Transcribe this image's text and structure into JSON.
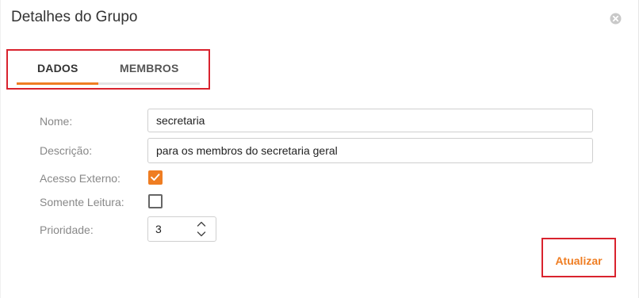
{
  "dialog": {
    "title": "Detalhes do Grupo"
  },
  "tabs": [
    {
      "label": "DADOS",
      "active": true
    },
    {
      "label": "MEMBROS",
      "active": false
    }
  ],
  "form": {
    "nome": {
      "label": "Nome:",
      "value": "secretaria"
    },
    "descricao": {
      "label": "Descrição:",
      "value": "para os membros do secretaria geral"
    },
    "acesso_externo": {
      "label": "Acesso Externo:",
      "checked": true
    },
    "somente_leitura": {
      "label": "Somente Leitura:",
      "checked": false
    },
    "prioridade": {
      "label": "Prioridade:",
      "value": "3"
    }
  },
  "actions": {
    "update_label": "Atualizar"
  },
  "colors": {
    "accent": "#ef7d22",
    "highlight": "#d9232e",
    "label": "#888888"
  },
  "icons": {
    "close": "close-icon",
    "check": "check-icon",
    "spinner": "chevron-up-down-icon"
  }
}
